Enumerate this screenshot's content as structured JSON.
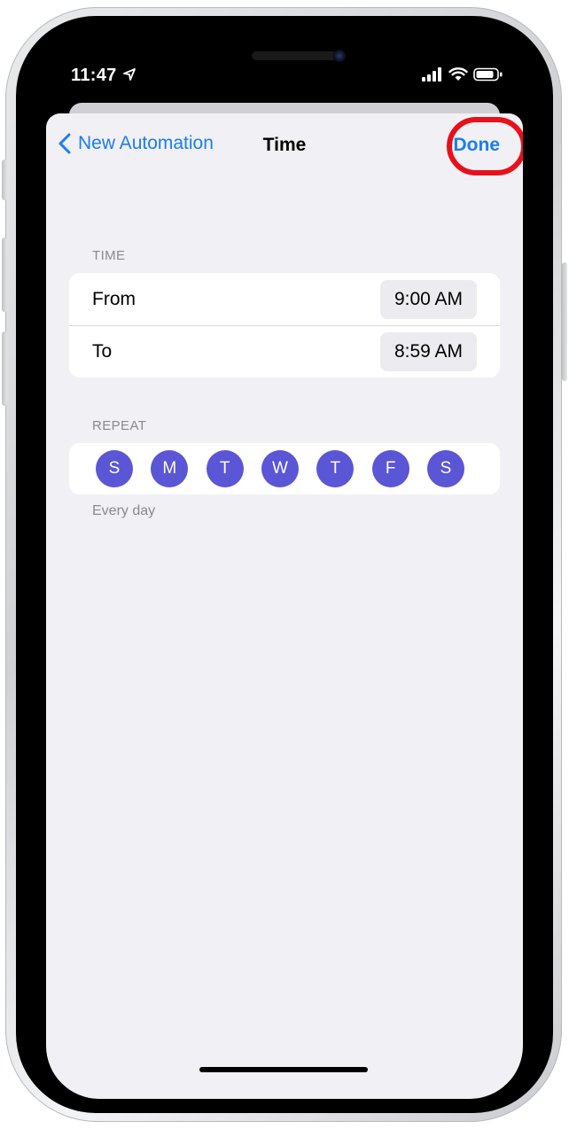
{
  "status_bar": {
    "time": "11:47",
    "icons": [
      "location-arrow-icon",
      "cellular-signal-icon",
      "wifi-icon",
      "battery-icon"
    ]
  },
  "nav": {
    "back_label": "New Automation",
    "title": "Time",
    "done_label": "Done"
  },
  "time_section": {
    "header": "TIME",
    "rows": [
      {
        "label": "From",
        "value": "9:00 AM"
      },
      {
        "label": "To",
        "value": "8:59 AM"
      }
    ]
  },
  "repeat_section": {
    "header": "REPEAT",
    "days": [
      "S",
      "M",
      "T",
      "W",
      "T",
      "F",
      "S"
    ],
    "summary": "Every day"
  },
  "colors": {
    "accent": "#1a7cf5",
    "day_selected": "#5a56d6",
    "annotation": "#e8101b",
    "sheet_background": "#f1f1f5"
  }
}
